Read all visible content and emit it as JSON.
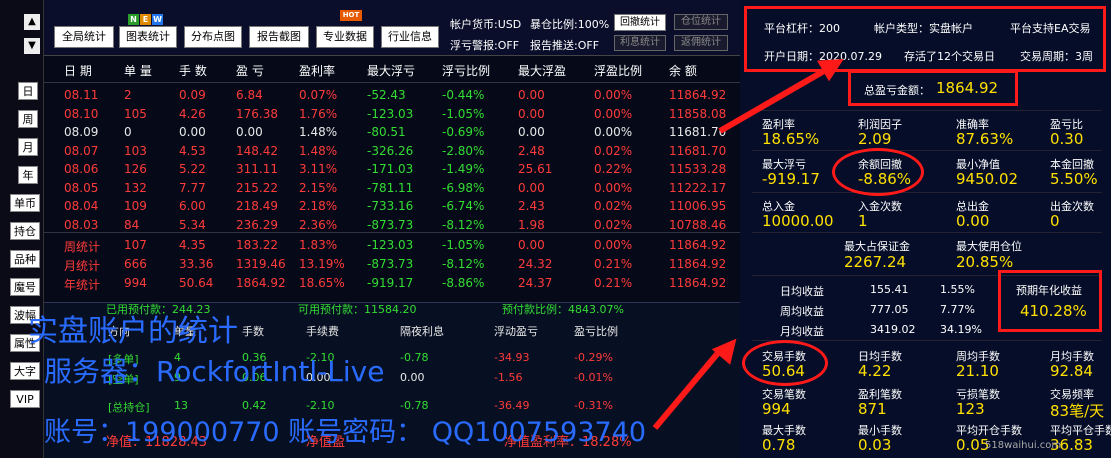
{
  "nav": {
    "up": "▲",
    "down": "▼"
  },
  "side_buttons": [
    "日",
    "周",
    "月",
    "年",
    "单币",
    "持仓",
    "品种",
    "魔号",
    "波幅",
    "属性",
    "大字",
    "VIP"
  ],
  "toolbar": {
    "buttons": [
      "全局统计",
      "图表统计",
      "分布点图",
      "报告截图",
      "专业数据",
      "行业信息"
    ],
    "badge_new": [
      "N",
      "E",
      "W"
    ],
    "badge_hot": "HOT",
    "account_currency": "帐户货币:USD",
    "exposure_ratio": "暴仓比例:100%",
    "float_alarm": "浮亏警报:OFF",
    "report_push": "报告推送:OFF",
    "btn_drawdown": "回撤统计",
    "btn_position": "仓位统计",
    "btn_interest": "利息统计",
    "btn_rebate": "返佣统计"
  },
  "table": {
    "headers": [
      "日 期",
      "单 量",
      "手 数",
      "盈 亏",
      "盈利率",
      "最大浮亏",
      "浮亏比例",
      "最大浮盈",
      "浮盈比例",
      "余 额"
    ],
    "rows": [
      {
        "date": "08.11",
        "orders": "2",
        "lots": "0.09",
        "pl": "6.84",
        "rate": "0.07%",
        "maxfl": "-52.43",
        "flr": "-0.44%",
        "maxfp": "0.00",
        "fpr": "0.00%",
        "bal": "11864.92",
        "color": "red"
      },
      {
        "date": "08.10",
        "orders": "105",
        "lots": "4.26",
        "pl": "176.38",
        "rate": "1.76%",
        "maxfl": "-123.03",
        "flr": "-1.05%",
        "maxfp": "0.00",
        "fpr": "0.00%",
        "bal": "11858.08",
        "color": "red"
      },
      {
        "date": "08.09",
        "orders": "0",
        "lots": "0.00",
        "pl": "0.00",
        "rate": "1.48%",
        "maxfl": "-80.51",
        "flr": "-0.69%",
        "maxfp": "0.00",
        "fpr": "0.00%",
        "bal": "11681.70",
        "color": "white"
      },
      {
        "date": "08.07",
        "orders": "103",
        "lots": "4.53",
        "pl": "148.42",
        "rate": "1.48%",
        "maxfl": "-326.26",
        "flr": "-2.80%",
        "maxfp": "2.48",
        "fpr": "0.02%",
        "bal": "11681.70",
        "color": "red"
      },
      {
        "date": "08.06",
        "orders": "126",
        "lots": "5.22",
        "pl": "311.11",
        "rate": "3.11%",
        "maxfl": "-171.03",
        "flr": "-1.49%",
        "maxfp": "25.61",
        "fpr": "0.22%",
        "bal": "11533.28",
        "color": "red"
      },
      {
        "date": "08.05",
        "orders": "132",
        "lots": "7.77",
        "pl": "215.22",
        "rate": "2.15%",
        "maxfl": "-781.11",
        "flr": "-6.98%",
        "maxfp": "0.00",
        "fpr": "0.00%",
        "bal": "11222.17",
        "color": "red"
      },
      {
        "date": "08.04",
        "orders": "109",
        "lots": "6.00",
        "pl": "218.49",
        "rate": "2.18%",
        "maxfl": "-733.16",
        "flr": "-6.74%",
        "maxfp": "2.43",
        "fpr": "0.02%",
        "bal": "11006.95",
        "color": "red"
      },
      {
        "date": "08.03",
        "orders": "84",
        "lots": "5.34",
        "pl": "236.29",
        "rate": "2.36%",
        "maxfl": "-873.73",
        "flr": "-8.12%",
        "maxfp": "1.98",
        "fpr": "0.02%",
        "bal": "10788.46",
        "color": "red"
      }
    ],
    "stats": [
      {
        "date": "周统计",
        "orders": "107",
        "lots": "4.35",
        "pl": "183.22",
        "rate": "1.83%",
        "maxfl": "-123.03",
        "flr": "-1.05%",
        "maxfp": "0.00",
        "fpr": "0.00%",
        "bal": "11864.92"
      },
      {
        "date": "月统计",
        "orders": "666",
        "lots": "33.36",
        "pl": "1319.46",
        "rate": "13.19%",
        "maxfl": "-873.73",
        "flr": "-8.12%",
        "maxfp": "24.32",
        "fpr": "0.21%",
        "bal": "11864.92"
      },
      {
        "date": "年统计",
        "orders": "994",
        "lots": "50.64",
        "pl": "1864.92",
        "rate": "18.65%",
        "maxfl": "-919.17",
        "flr": "-8.86%",
        "maxfp": "24.37",
        "fpr": "0.21%",
        "bal": "11864.92"
      }
    ]
  },
  "lower": {
    "used_margin": "已用预付款：244.23",
    "free_margin": "可用预付款：11584.20",
    "margin_ratio": "预付款比例：4843.07%",
    "headers": [
      "方向",
      "单量",
      "手数",
      "手续费",
      "隔夜利息",
      "浮动盈亏",
      "盈亏比例"
    ],
    "rows": [
      {
        "dir": "[多单]",
        "orders": "4",
        "lots": "0.36",
        "fee": "-2.10",
        "swap": "-0.78",
        "fpl": "-34.93",
        "ratio": "-0.29%"
      },
      {
        "dir": "[空单]",
        "orders": "9",
        "lots": "0.06",
        "fee": "0.00",
        "swap": "0.00",
        "fpl": "-1.56",
        "ratio": "-0.01%"
      },
      {
        "dir": "[总持仓]",
        "orders": "13",
        "lots": "0.42",
        "fee": "-2.10",
        "swap": "-0.78",
        "fpl": "-36.49",
        "ratio": "-0.31%"
      }
    ],
    "net": "净值：11828.43",
    "bottom_mid": "净值盈",
    "bottom_right": "净值盈利率：18.28%"
  },
  "right": {
    "leverage": "平台杠杆：200",
    "account_type": "帐户类型：实盘帐户",
    "ea_support": "平台支持EA交易",
    "open_date": "开户日期：2020.07.29",
    "survived": "存活了12个交易日",
    "cycle": "交易周期：3周",
    "total_pl_label": "总盈亏金额：",
    "total_pl": "1864.92",
    "metrics1": [
      {
        "label": "盈利率",
        "value": "18.65%"
      },
      {
        "label": "利润因子",
        "value": "2.09"
      },
      {
        "label": "准确率",
        "value": "87.63%"
      },
      {
        "label": "盈亏比",
        "value": "0.30"
      }
    ],
    "metrics2": [
      {
        "label": "最大浮亏",
        "value": "-919.17"
      },
      {
        "label": "余额回撤",
        "value": "-8.86%"
      },
      {
        "label": "最小净值",
        "value": "9450.02"
      },
      {
        "label": "本金回撤",
        "value": "5.50%"
      }
    ],
    "metrics3": [
      {
        "label": "总入金",
        "value": "10000.00"
      },
      {
        "label": "入金次数",
        "value": "1"
      },
      {
        "label": "总出金",
        "value": "0.00"
      },
      {
        "label": "出金次数",
        "value": "0"
      }
    ],
    "max_margin_label": "最大占保证金",
    "max_margin": "2267.24",
    "max_pos_label": "最大使用仓位",
    "max_pos": "20.85%",
    "income": [
      {
        "label": "日均收益",
        "value": "155.41",
        "pct": "1.55%"
      },
      {
        "label": "周均收益",
        "value": "777.05",
        "pct": "7.77%"
      },
      {
        "label": "月均收益",
        "value": "3419.02",
        "pct": "34.19%"
      }
    ],
    "annual_label": "预期年化收益",
    "annual": "410.28%",
    "metrics4": [
      {
        "label": "交易手数",
        "value": "50.64"
      },
      {
        "label": "日均手数",
        "value": "4.22"
      },
      {
        "label": "周均手数",
        "value": "21.10"
      },
      {
        "label": "月均手数",
        "value": "92.84"
      }
    ],
    "metrics5": [
      {
        "label": "交易笔数",
        "value": "994"
      },
      {
        "label": "盈利笔数",
        "value": "871"
      },
      {
        "label": "亏损笔数",
        "value": "123"
      },
      {
        "label": "交易频率",
        "value": "83笔/天"
      }
    ],
    "metrics6": [
      {
        "label": "最大手数",
        "value": "0.78"
      },
      {
        "label": "最小手数",
        "value": "0.03"
      },
      {
        "label": "平均开仓手数",
        "value": "0.05"
      },
      {
        "label": "平均平仓手数",
        "value": "36.83"
      }
    ]
  },
  "overlay": {
    "line1": "实盘账户的统计",
    "line2": "服务器：RockfortIntl-Live",
    "line3": "账号：199000770  账号密码：  QQ1007593740",
    "watermark": "518waihui.com"
  }
}
